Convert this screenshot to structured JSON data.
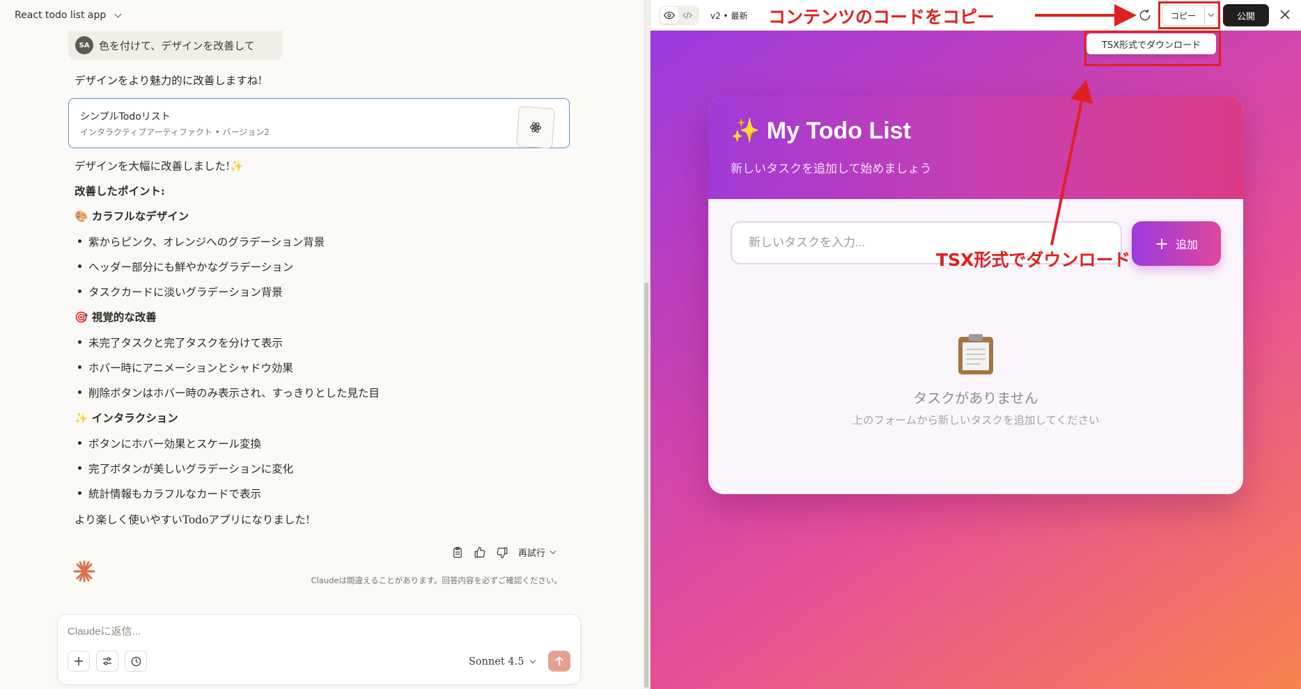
{
  "left_header": {
    "title": "React todo list app"
  },
  "user_message": {
    "avatar": "SA",
    "text": "色を付けて、デザインを改善して"
  },
  "response": {
    "intro": "デザインをより魅力的に改善しますね!",
    "artifact": {
      "title": "シンプルTodoリスト",
      "subtitle": "インタラクティブアーティファクト • バージョン2"
    },
    "improved": "デザインを大幅に改善しました!✨",
    "points_title": "改善したポイント:",
    "sections": [
      {
        "icon": "🎨",
        "title": "カラフルなデザイン",
        "items": [
          "紫からピンク、オレンジへのグラデーション背景",
          "ヘッダー部分にも鮮やかなグラデーション",
          "タスクカードに淡いグラデーション背景"
        ]
      },
      {
        "icon": "🎯",
        "title": "視覚的な改善",
        "items": [
          "未完了タスクと完了タスクを分けて表示",
          "ホバー時にアニメーションとシャドウ効果",
          "削除ボタンはホバー時のみ表示され、すっきりとした見た目"
        ]
      },
      {
        "icon": "✨",
        "title": "インタラクション",
        "items": [
          "ボタンにホバー効果とスケール変換",
          "完了ボタンが美しいグラデーションに変化",
          "統計情報もカラフルなカードで表示"
        ]
      }
    ],
    "closing": "より楽しく使いやすいTodoアプリになりました!"
  },
  "actions": {
    "retry_label": "再試行"
  },
  "disclaimer": "Claudeは間違えることがあります。回答内容を必ずご確認ください。",
  "composer": {
    "placeholder": "Claudeに返信...",
    "model": "Sonnet 4.5"
  },
  "right_toolbar": {
    "version": "v2 • 最新",
    "copy_label": "コピー",
    "publish_label": "公開"
  },
  "dropdown": {
    "tsx_label": "TSX形式でダウンロード"
  },
  "todo_app": {
    "title": "✨ My Todo List",
    "subtitle": "新しいタスクを追加して始めましょう",
    "input_placeholder": "新しいタスクを入力...",
    "add_label": "追加",
    "empty_icon": "📋",
    "empty_title": "タスクがありません",
    "empty_subtitle": "上のフォームから新しいタスクを追加してください"
  },
  "annotations": {
    "copy_note": "コンテンツのコードをコピー",
    "tsx_note": "TSX形式でダウンロード"
  },
  "colors": {
    "accent_purple": "#9a3ae0",
    "accent_pink": "#e0479b",
    "annotation_red": "#e02020",
    "publish_bg": "#1f1e1c"
  }
}
